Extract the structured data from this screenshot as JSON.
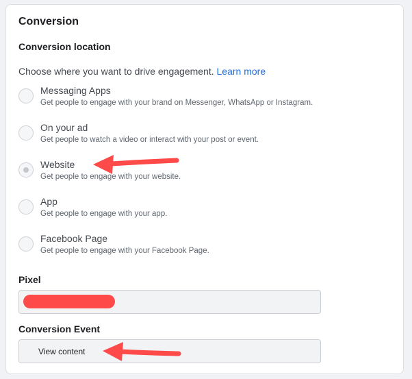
{
  "section": {
    "title": "Conversion"
  },
  "conversion_location": {
    "title": "Conversion location",
    "description": "Choose where you want to drive engagement.",
    "learn_more": "Learn more",
    "options": [
      {
        "label": "Messaging Apps",
        "description": "Get people to engage with your brand on Messenger, WhatsApp or Instagram.",
        "selected": false
      },
      {
        "label": "On your ad",
        "description": "Get people to watch a video or interact with your post or event.",
        "selected": false
      },
      {
        "label": "Website",
        "description": "Get people to engage with your website.",
        "selected": true
      },
      {
        "label": "App",
        "description": "Get people to engage with your app.",
        "selected": false
      },
      {
        "label": "Facebook Page",
        "description": "Get people to engage with your Facebook Page.",
        "selected": false
      }
    ]
  },
  "pixel": {
    "label": "Pixel"
  },
  "conversion_event": {
    "label": "Conversion Event",
    "value": "View content"
  },
  "colors": {
    "annotation_red": "#ff4a4a",
    "link_blue": "#216fdb"
  }
}
